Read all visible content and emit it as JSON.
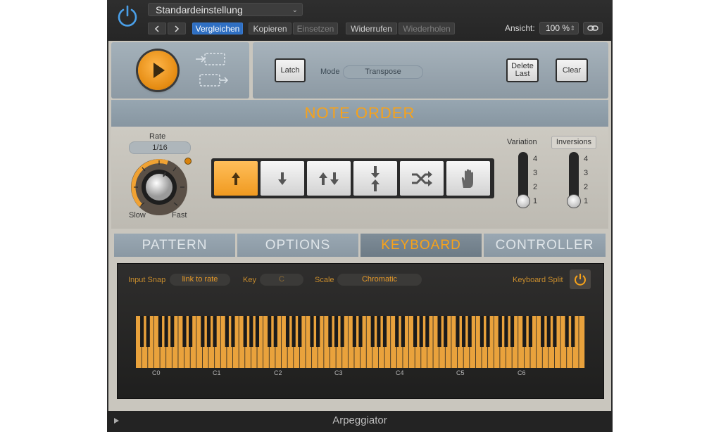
{
  "header": {
    "preset": "Standardeinstellung",
    "back_icon": "chevron-left-icon",
    "forward_icon": "chevron-right-icon",
    "compare": "Vergleichen",
    "copy": "Kopieren",
    "paste": "Einsetzen",
    "undo": "Widerrufen",
    "redo": "Wiederholen",
    "view_label": "Ansicht:",
    "zoom": "100 %"
  },
  "transport": {
    "latch": "Latch",
    "mode_label": "Mode",
    "mode_value": "Transpose",
    "delete_last": "Delete Last",
    "clear": "Clear"
  },
  "note_order": {
    "title": "NOTE ORDER",
    "rate_label": "Rate",
    "rate_value": "1/16",
    "slow": "Slow",
    "fast": "Fast",
    "buttons": [
      {
        "icon": "arrow-up-icon",
        "selected": true
      },
      {
        "icon": "arrow-down-icon",
        "selected": false
      },
      {
        "icon": "up-down-arrows-icon",
        "selected": false
      },
      {
        "icon": "converge-arrows-icon",
        "selected": false
      },
      {
        "icon": "shuffle-icon",
        "selected": false
      },
      {
        "icon": "hand-icon",
        "selected": false
      }
    ],
    "variation_label": "Variation",
    "variation_value": 1,
    "inversions_label": "Inversions",
    "inversions_value": 1,
    "scale_numbers": [
      "4",
      "3",
      "2",
      "1"
    ]
  },
  "tabs": [
    "PATTERN",
    "OPTIONS",
    "KEYBOARD",
    "CONTROLLER"
  ],
  "selected_tab": 2,
  "keyboard": {
    "input_snap_label": "Input Snap",
    "input_snap_value": "link to rate",
    "key_label": "Key",
    "key_value": "C",
    "scale_label": "Scale",
    "scale_value": "Chromatic",
    "split_label": "Keyboard Split",
    "octaves": [
      "C0",
      "C1",
      "C2",
      "C3",
      "C4",
      "C5",
      "C6"
    ]
  },
  "footer": {
    "title": "Arpeggiator"
  },
  "colors": {
    "accent": "#f7a21a",
    "key_orange": "#e9a23c",
    "compare_blue": "#2f6fc2"
  }
}
